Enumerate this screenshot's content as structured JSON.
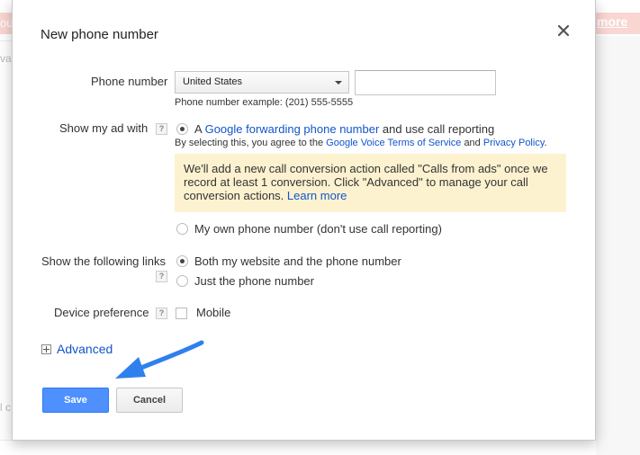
{
  "background": {
    "banner_left": "ou",
    "more_link": "more",
    "left_snippets": [
      "va",
      "l c"
    ]
  },
  "dialog": {
    "title": "New phone number",
    "phone_number": {
      "label": "Phone number",
      "country": "United States",
      "value": "",
      "example": "Phone number example: (201) 555-5555"
    },
    "show_ad_with": {
      "label": "Show my ad with",
      "help": "?",
      "option_google": {
        "prefix": "A",
        "link": "Google forwarding phone number",
        "suffix": "and use call reporting",
        "selected": true
      },
      "agreement": {
        "prefix": "By selecting this, you agree to the",
        "tos_link": "Google Voice Terms of Service",
        "and": "and",
        "privacy_link": "Privacy Policy",
        "end": "."
      },
      "info": {
        "text": "We'll add a new call conversion action called \"Calls from ads\" once we record at least 1 conversion. Click \"Advanced\" to manage your call conversion actions.",
        "learn_more": "Learn more"
      },
      "option_own": {
        "text": "My own phone number (don't use call reporting)",
        "selected": false
      }
    },
    "links": {
      "label": "Show the following links",
      "help": "?",
      "option_both": {
        "text": "Both my website and the phone number",
        "selected": true
      },
      "option_phone": {
        "text": "Just the phone number",
        "selected": false
      }
    },
    "device": {
      "label": "Device preference",
      "help": "?",
      "mobile": {
        "text": "Mobile",
        "checked": false
      }
    },
    "advanced": {
      "label": "Advanced"
    },
    "buttons": {
      "save": "Save",
      "cancel": "Cancel"
    },
    "colors": {
      "primary_button": "#4d90fe",
      "link": "#1155cc",
      "info_bg": "#fdf2d0",
      "arrow": "#2f80ed"
    },
    "icons": {
      "close": "close-icon",
      "expand": "plus-box-icon",
      "pointer": "arrow-icon"
    }
  }
}
